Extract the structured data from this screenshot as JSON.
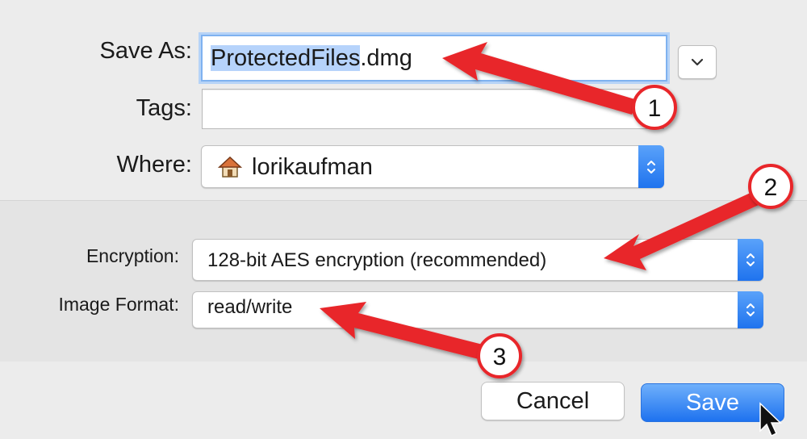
{
  "dialog": {
    "save_as": {
      "label": "Save As:",
      "value_selected": "ProtectedFiles",
      "value_rest": ".dmg"
    },
    "tags": {
      "label": "Tags:",
      "value": ""
    },
    "where": {
      "label": "Where:",
      "value": "lorikaufman",
      "icon": "home-folder-icon"
    },
    "encryption": {
      "label": "Encryption:",
      "value": "128-bit AES encryption (recommended)"
    },
    "image_format": {
      "label": "Image Format:",
      "value": "read/write"
    },
    "buttons": {
      "cancel": "Cancel",
      "save": "Save"
    }
  },
  "annotations": [
    {
      "number": "1"
    },
    {
      "number": "2"
    },
    {
      "number": "3"
    }
  ],
  "colors": {
    "accent": "#1e72ef",
    "arrow": "#e8262a",
    "selection": "#b6d3fb"
  }
}
